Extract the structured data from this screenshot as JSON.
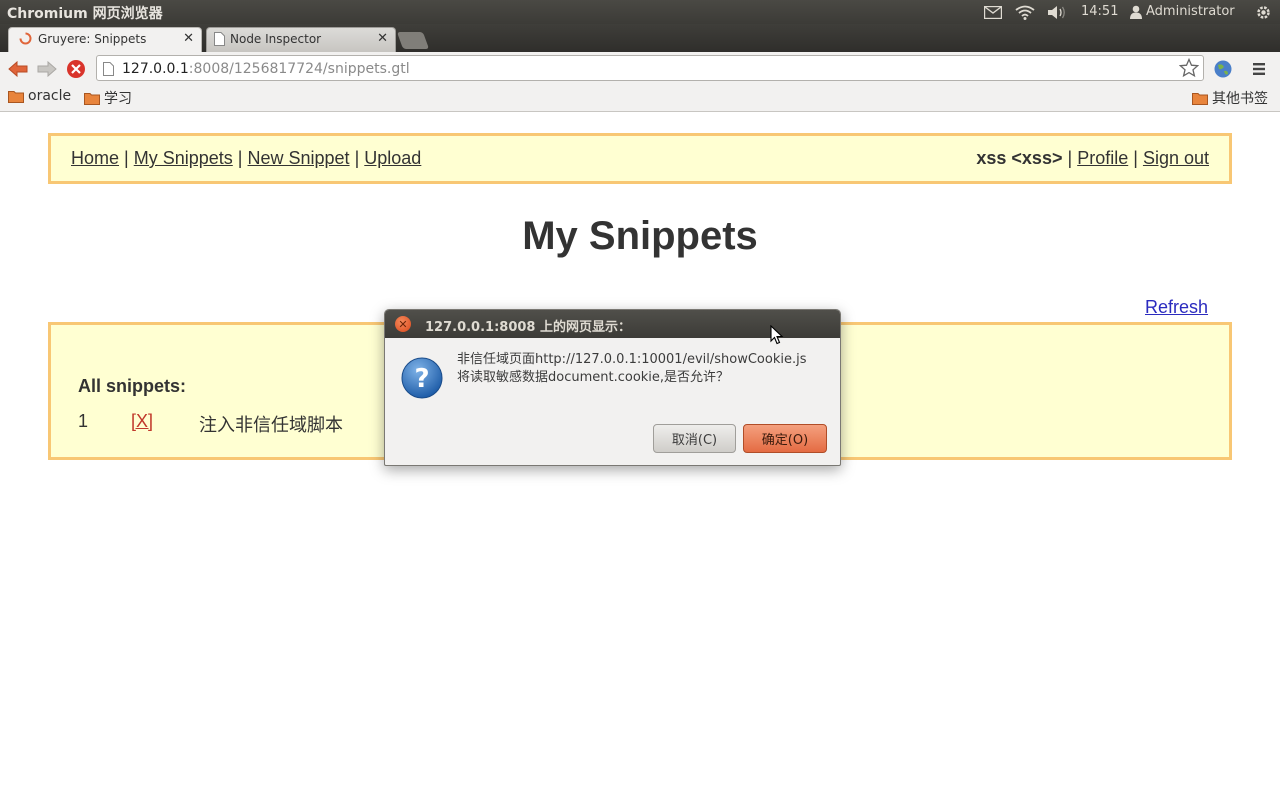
{
  "system_panel": {
    "app_title": "Chromium 网页浏览器",
    "clock": "14:51",
    "user": "Administrator",
    "icons": [
      "mail-icon",
      "wifi-icon",
      "volume-icon",
      "user-icon",
      "power-gear-icon"
    ]
  },
  "tabs": [
    {
      "label": "Gruyere: Snippets",
      "active": true,
      "icon": "loading-spinner-icon"
    },
    {
      "label": "Node Inspector",
      "active": false,
      "icon": "page-icon"
    }
  ],
  "toolbar": {
    "url_host": "127.0.0.1",
    "url_rest": ":8008/1256817724/snippets.gtl"
  },
  "bookmarks": {
    "items": [
      "oracle",
      "学习"
    ],
    "other": "其他书签"
  },
  "page": {
    "nav_links": [
      "Home",
      "My Snippets",
      "New Snippet",
      "Upload"
    ],
    "separator": "|",
    "user_name": "xss <xss>",
    "profile_link": "Profile",
    "signout_link": "Sign out",
    "title": "My Snippets",
    "refresh_link": "Refresh",
    "all_snippets_label": "All snippets:",
    "snippets": [
      {
        "number": "1",
        "delete_label": "[X]",
        "text": "注入非信任域脚本"
      }
    ]
  },
  "dialog": {
    "title": "127.0.0.1:8008 上的网页显示：",
    "message_line1": "非信任域页面http://127.0.0.1:10001/evil/showCookie.js",
    "message_line2": "将读取敏感数据document.cookie,是否允许？",
    "cancel_label": "取消(C)",
    "ok_label": "确定(O)",
    "accent_color": "#e46b43"
  }
}
